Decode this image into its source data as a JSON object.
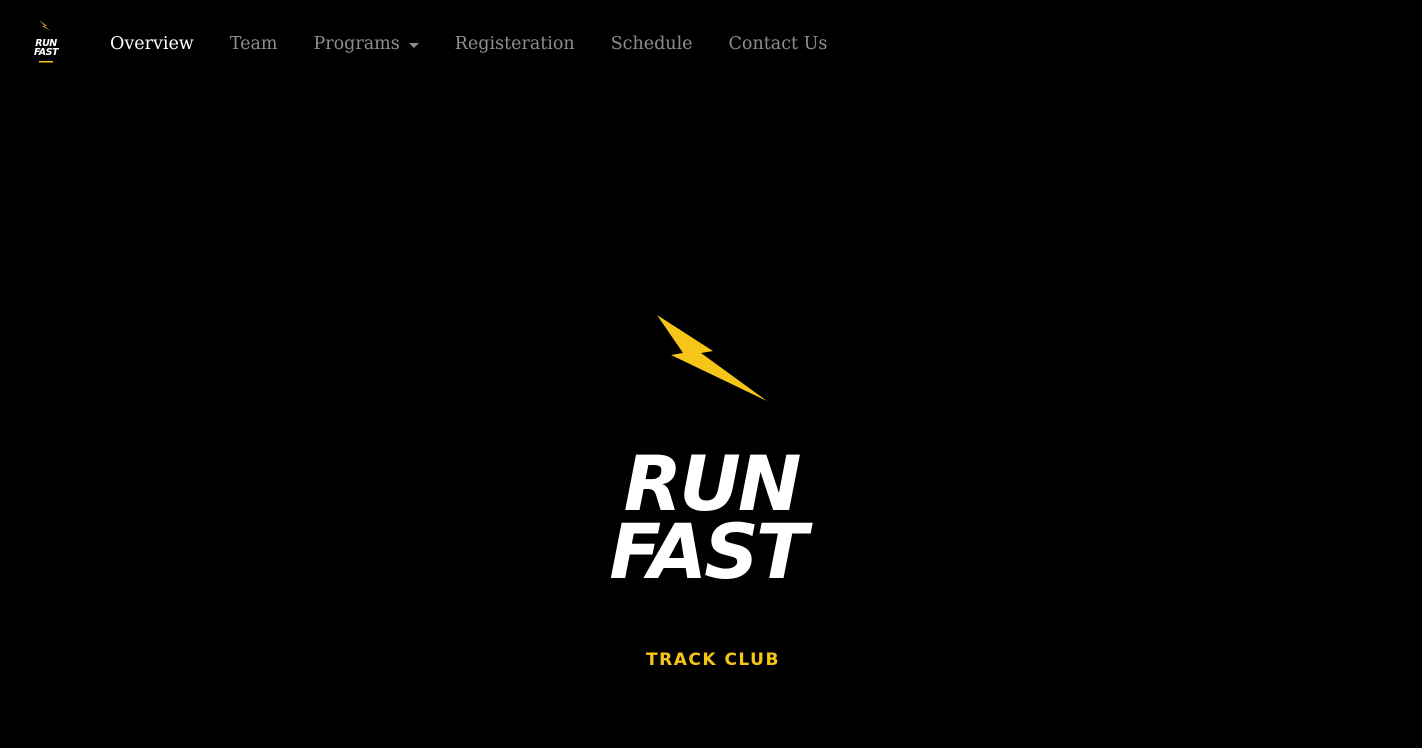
{
  "navbar": {
    "logo_line1": "RUN",
    "logo_line2": "FAST",
    "links": [
      {
        "label": "Overview",
        "active": true
      },
      {
        "label": "Team",
        "active": false
      },
      {
        "label": "Programs",
        "active": false,
        "dropdown": true
      },
      {
        "label": "Registeration",
        "active": false
      },
      {
        "label": "Schedule",
        "active": false
      },
      {
        "label": "Contact Us",
        "active": false
      }
    ]
  },
  "hero": {
    "icon": "lightning-bolt-icon",
    "title_line1": "RUN",
    "title_line2": "FAST",
    "subtitle": "TRACK CLUB"
  },
  "colors": {
    "background": "#000000",
    "accent": "#f5c518",
    "text": "#ffffff",
    "nav_inactive": "rgba(255,255,255,0.55)"
  }
}
